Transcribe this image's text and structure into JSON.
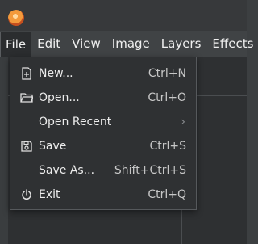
{
  "menubar": {
    "menus": [
      "File",
      "Edit",
      "View",
      "Image",
      "Layers",
      "Effects"
    ]
  },
  "file_menu": {
    "items": [
      {
        "label": "New...",
        "shortcut": "Ctrl+N",
        "icon": "new-file-icon"
      },
      {
        "label": "Open...",
        "shortcut": "Ctrl+O",
        "icon": "folder-icon"
      },
      {
        "label": "Open Recent",
        "shortcut": "",
        "icon": "",
        "submenu": true
      },
      {
        "label": "Save",
        "shortcut": "Ctrl+S",
        "icon": "save-icon"
      },
      {
        "label": "Save As...",
        "shortcut": "Shift+Ctrl+S",
        "icon": ""
      },
      {
        "label": "Exit",
        "shortcut": "Ctrl+Q",
        "icon": "power-icon"
      }
    ],
    "submenu_arrow": "›"
  },
  "colors": {
    "menu_bg": "#2f3133",
    "menubar_bg": "#404345",
    "text": "#ececec"
  }
}
